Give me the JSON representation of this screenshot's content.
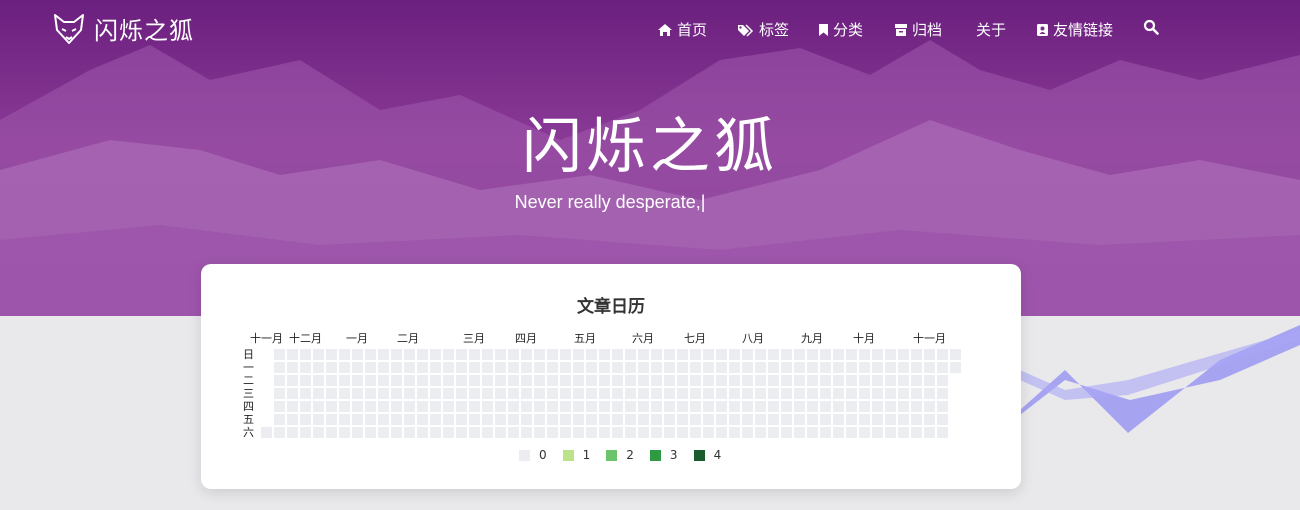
{
  "site": {
    "brand": "闪烁之狐",
    "hero_title": "闪烁之狐",
    "hero_subtitle": "Never really desperate,|"
  },
  "nav": [
    {
      "icon": "home-icon",
      "label": "首页"
    },
    {
      "icon": "tags-icon",
      "label": "标签"
    },
    {
      "icon": "bookmark-icon",
      "label": "分类"
    },
    {
      "icon": "archive-icon",
      "label": "归档"
    },
    {
      "icon": "",
      "label": "关于"
    },
    {
      "icon": "address-book-icon",
      "label": "友情链接"
    },
    {
      "icon": "search-icon",
      "label": ""
    }
  ],
  "calendar": {
    "title": "文章日历",
    "months": [
      "十一月",
      "十二月",
      "一月",
      "二月",
      "三月",
      "四月",
      "五月",
      "六月",
      "七月",
      "八月",
      "九月",
      "十月",
      "十一月"
    ],
    "weekdays": [
      "日",
      "一",
      "二",
      "三",
      "四",
      "五",
      "六"
    ],
    "legend": [
      {
        "label": "0",
        "color": "#ebedf0"
      },
      {
        "label": "1",
        "color": "#bce38a"
      },
      {
        "label": "2",
        "color": "#6cc46a"
      },
      {
        "label": "3",
        "color": "#2e9a44"
      },
      {
        "label": "4",
        "color": "#1a5d2c"
      }
    ]
  },
  "colors": {
    "hero": "#7d2f8b",
    "wave": "#8f8cf2"
  }
}
